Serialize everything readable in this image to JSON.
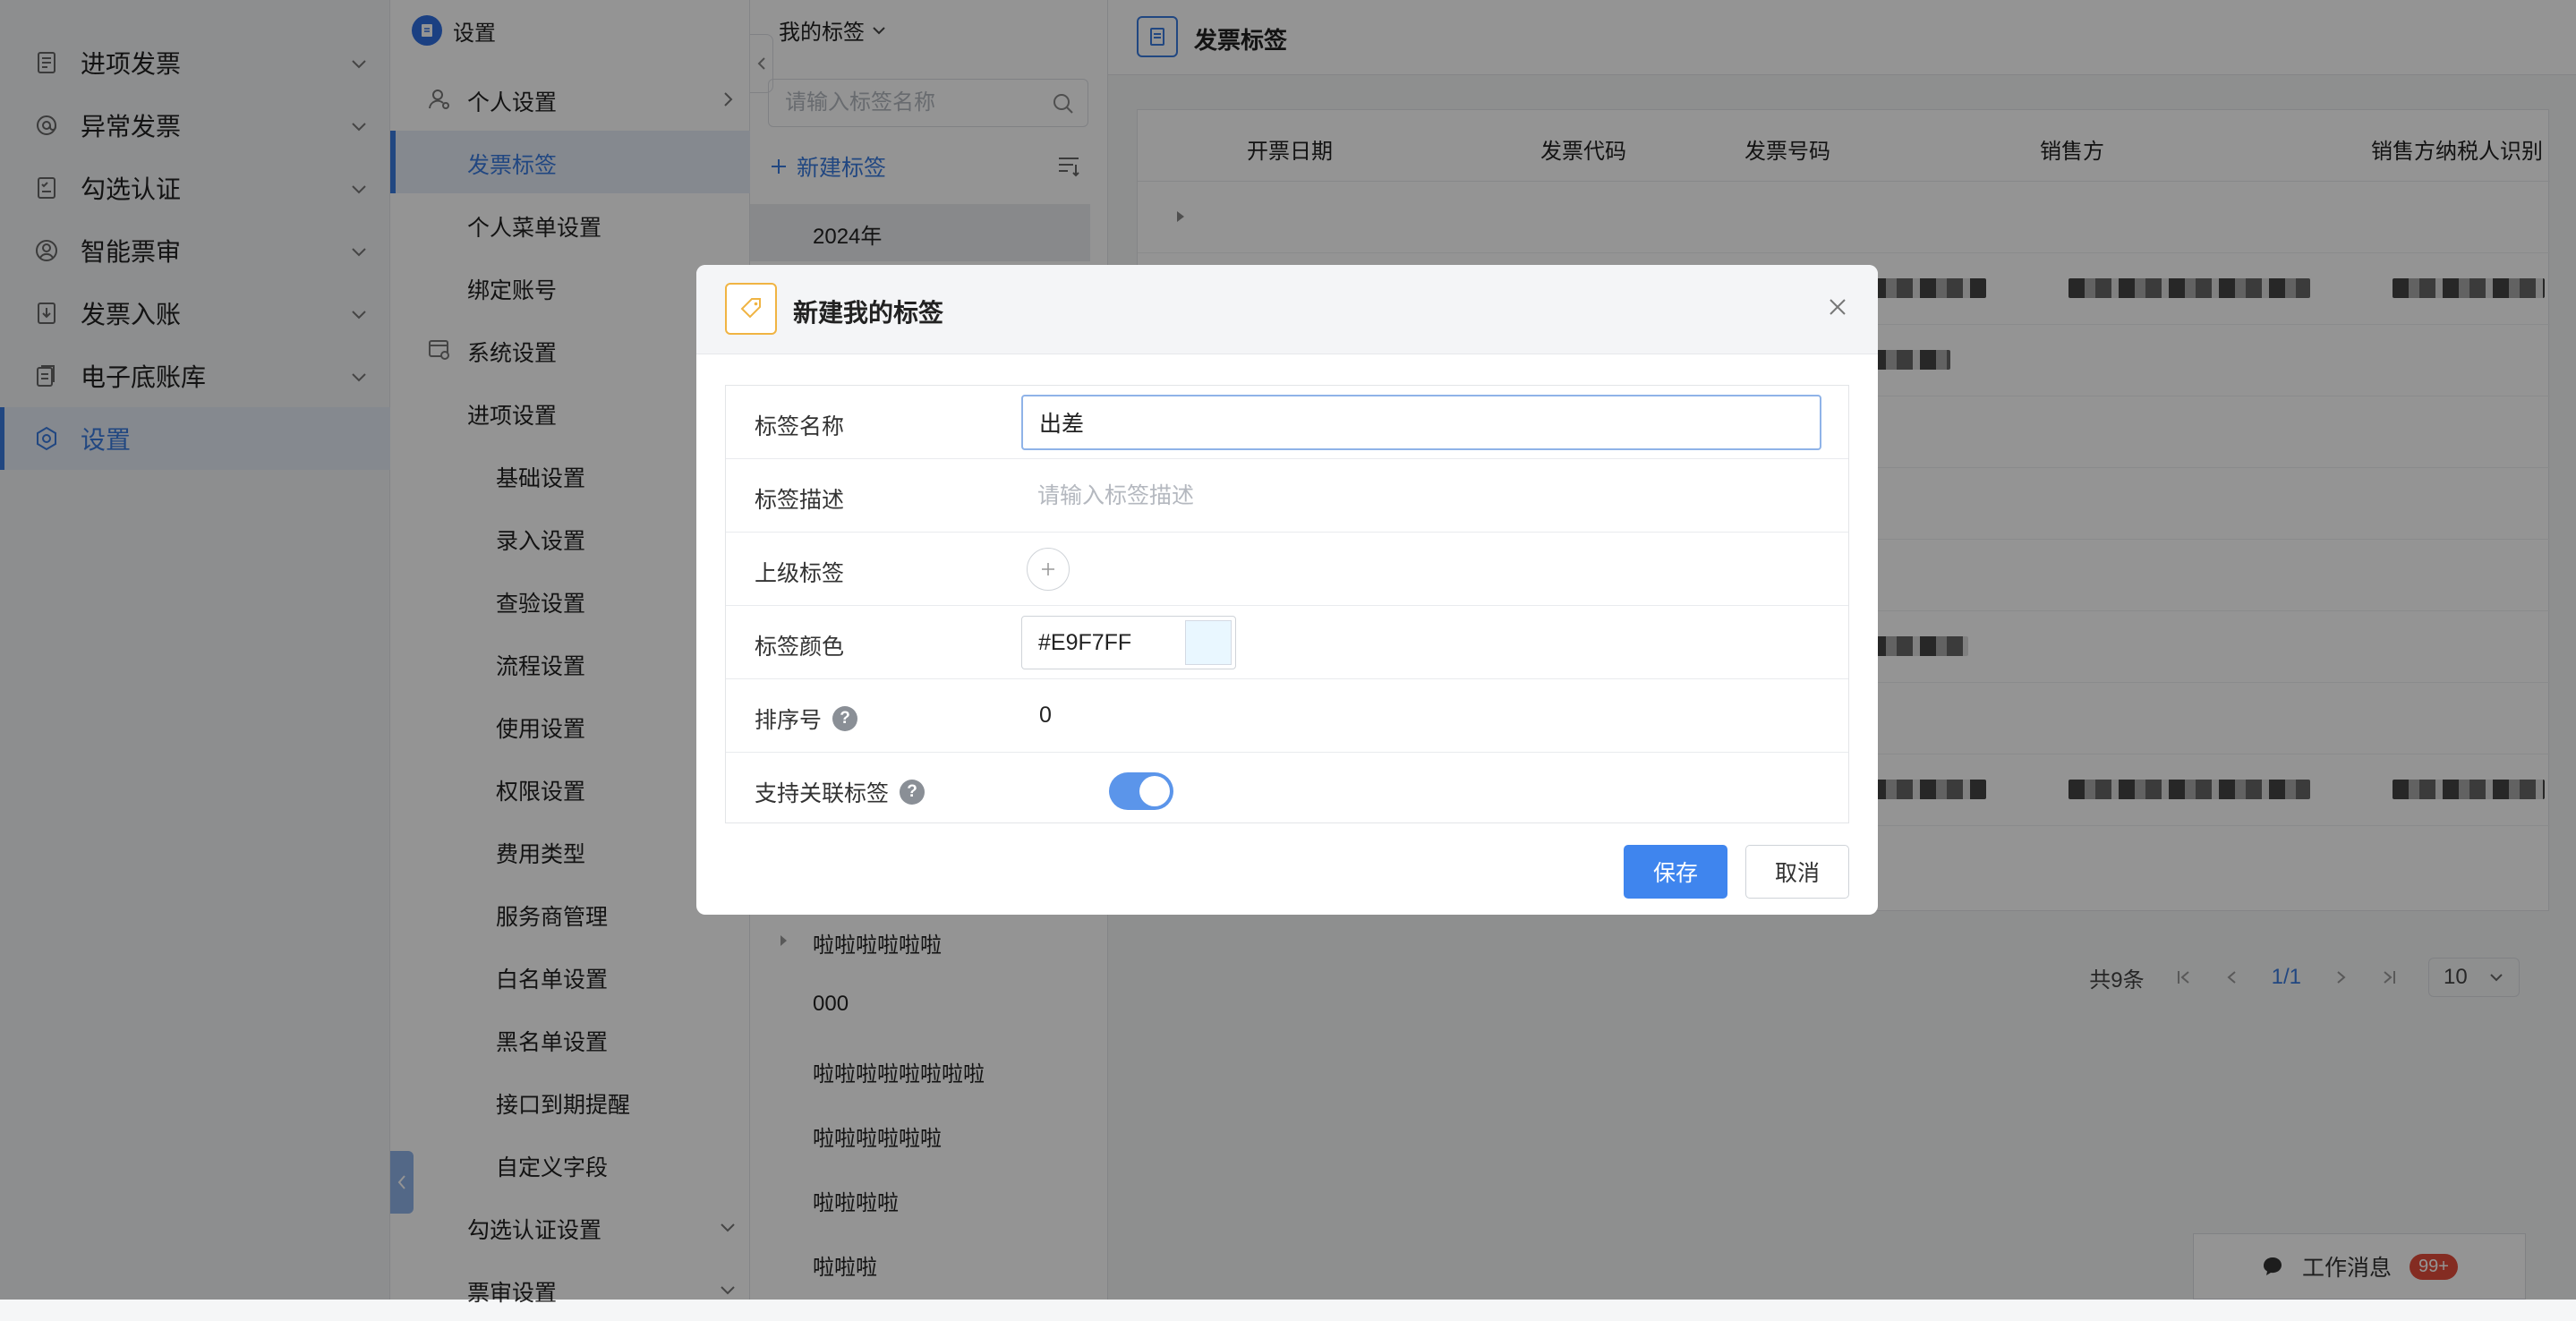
{
  "nav": {
    "items": [
      {
        "label": "进项发票",
        "icon": "invoice-icon"
      },
      {
        "label": "异常发票",
        "icon": "at-sign-icon"
      },
      {
        "label": "勾选认证",
        "icon": "checklist-icon"
      },
      {
        "label": "智能票审",
        "icon": "user-circle-icon"
      },
      {
        "label": "发票入账",
        "icon": "download-doc-icon"
      },
      {
        "label": "电子底账库",
        "icon": "ledger-icon"
      },
      {
        "label": "设置",
        "icon": "hexagon-gear-icon",
        "active": true
      }
    ]
  },
  "settings": {
    "title": "设置",
    "personal": "个人设置",
    "invoice_tags": "发票标签",
    "personal_menu": "个人菜单设置",
    "bind_account": "绑定账号",
    "system": "系统设置",
    "input_settings": "进项设置",
    "children": [
      "基础设置",
      "录入设置",
      "查验设置",
      "流程设置",
      "使用设置",
      "权限设置",
      "费用类型",
      "服务商管理",
      "白名单设置",
      "黑名单设置",
      "接口到期提醒",
      "自定义字段"
    ],
    "check_auth": "勾选认证设置",
    "review": "票审设置"
  },
  "tags_panel": {
    "title": "我的标签",
    "search_placeholder": "请输入标签名称",
    "new_tag": "新建标签",
    "items": [
      {
        "label": "2024年",
        "selected": true
      },
      {
        "label": "啦啦啦啦啦啦",
        "expandable": true
      },
      {
        "label": "000"
      },
      {
        "label": "啦啦啦啦啦啦啦啦"
      },
      {
        "label": "啦啦啦啦啦啦"
      },
      {
        "label": "啦啦啦啦"
      },
      {
        "label": "啦啦啦"
      }
    ]
  },
  "main": {
    "title": "发票标签",
    "columns": [
      "开票日期",
      "发票代码",
      "发票号码",
      "销售方",
      "销售方纳税人识别"
    ],
    "pagination": {
      "total": "共9条",
      "page": "1/1",
      "page_size": "10"
    }
  },
  "messages": {
    "label": "工作消息",
    "badge": "99+"
  },
  "modal": {
    "title": "新建我的标签",
    "fields": {
      "name_label": "标签名称",
      "name_value": "出差",
      "desc_label": "标签描述",
      "desc_placeholder": "请输入标签描述",
      "parent_label": "上级标签",
      "color_label": "标签颜色",
      "color_value": "#E9F7FF",
      "order_label": "排序号",
      "order_value": "0",
      "relate_label": "支持关联标签",
      "relate_enabled": true
    },
    "save": "保存",
    "cancel": "取消"
  },
  "colors": {
    "accent": "#3a7bdf",
    "tag_badge": "#f0b443",
    "swatch": "#E9F7FF"
  }
}
